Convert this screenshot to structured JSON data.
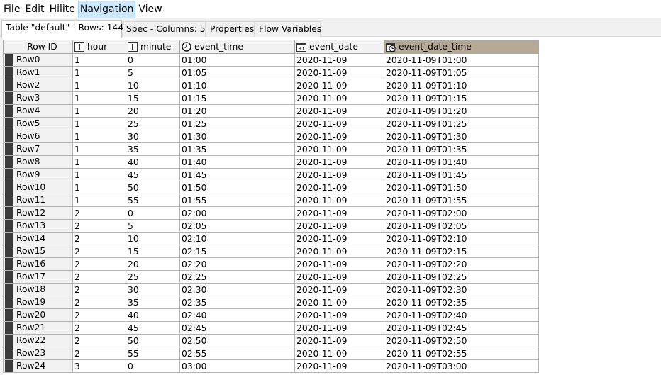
{
  "menu": [
    "File",
    "Edit",
    "Hilite",
    "Navigation",
    "View"
  ],
  "tabs": [
    "Table \"default\" - Rows: 144",
    "Spec - Columns: 5",
    "Properties",
    "Flow Variables"
  ],
  "table": {
    "columns": [
      {
        "label": "Row ID",
        "icon": "none"
      },
      {
        "label": "hour",
        "icon": "integer-type-icon"
      },
      {
        "label": "minute",
        "icon": "integer-type-icon"
      },
      {
        "label": "event_time",
        "icon": "clock-icon"
      },
      {
        "label": "event_date",
        "icon": "calendar-icon"
      },
      {
        "label": "event_date_time",
        "icon": "datetime-icon"
      }
    ],
    "rows": [
      [
        "Row0",
        "1",
        "0",
        "01:00",
        "2020-11-09",
        "2020-11-09T01:00"
      ],
      [
        "Row1",
        "1",
        "5",
        "01:05",
        "2020-11-09",
        "2020-11-09T01:05"
      ],
      [
        "Row2",
        "1",
        "10",
        "01:10",
        "2020-11-09",
        "2020-11-09T01:10"
      ],
      [
        "Row3",
        "1",
        "15",
        "01:15",
        "2020-11-09",
        "2020-11-09T01:15"
      ],
      [
        "Row4",
        "1",
        "20",
        "01:20",
        "2020-11-09",
        "2020-11-09T01:20"
      ],
      [
        "Row5",
        "1",
        "25",
        "01:25",
        "2020-11-09",
        "2020-11-09T01:25"
      ],
      [
        "Row6",
        "1",
        "30",
        "01:30",
        "2020-11-09",
        "2020-11-09T01:30"
      ],
      [
        "Row7",
        "1",
        "35",
        "01:35",
        "2020-11-09",
        "2020-11-09T01:35"
      ],
      [
        "Row8",
        "1",
        "40",
        "01:40",
        "2020-11-09",
        "2020-11-09T01:40"
      ],
      [
        "Row9",
        "1",
        "45",
        "01:45",
        "2020-11-09",
        "2020-11-09T01:45"
      ],
      [
        "Row10",
        "1",
        "50",
        "01:50",
        "2020-11-09",
        "2020-11-09T01:50"
      ],
      [
        "Row11",
        "1",
        "55",
        "01:55",
        "2020-11-09",
        "2020-11-09T01:55"
      ],
      [
        "Row12",
        "2",
        "0",
        "02:00",
        "2020-11-09",
        "2020-11-09T02:00"
      ],
      [
        "Row13",
        "2",
        "5",
        "02:05",
        "2020-11-09",
        "2020-11-09T02:05"
      ],
      [
        "Row14",
        "2",
        "10",
        "02:10",
        "2020-11-09",
        "2020-11-09T02:10"
      ],
      [
        "Row15",
        "2",
        "15",
        "02:15",
        "2020-11-09",
        "2020-11-09T02:15"
      ],
      [
        "Row16",
        "2",
        "20",
        "02:20",
        "2020-11-09",
        "2020-11-09T02:20"
      ],
      [
        "Row17",
        "2",
        "25",
        "02:25",
        "2020-11-09",
        "2020-11-09T02:25"
      ],
      [
        "Row18",
        "2",
        "30",
        "02:30",
        "2020-11-09",
        "2020-11-09T02:30"
      ],
      [
        "Row19",
        "2",
        "35",
        "02:35",
        "2020-11-09",
        "2020-11-09T02:35"
      ],
      [
        "Row20",
        "2",
        "40",
        "02:40",
        "2020-11-09",
        "2020-11-09T02:40"
      ],
      [
        "Row21",
        "2",
        "45",
        "02:45",
        "2020-11-09",
        "2020-11-09T02:45"
      ],
      [
        "Row22",
        "2",
        "50",
        "02:50",
        "2020-11-09",
        "2020-11-09T02:50"
      ],
      [
        "Row23",
        "2",
        "55",
        "02:55",
        "2020-11-09",
        "2020-11-09T02:55"
      ],
      [
        "Row24",
        "3",
        "0",
        "03:00",
        "2020-11-09",
        "2020-11-09T03:00"
      ]
    ]
  },
  "colors": {
    "menu_active_bg": "#cce8ff",
    "sorted_header_bg": "#b4a896",
    "row_marker": "#3c3c3c"
  }
}
